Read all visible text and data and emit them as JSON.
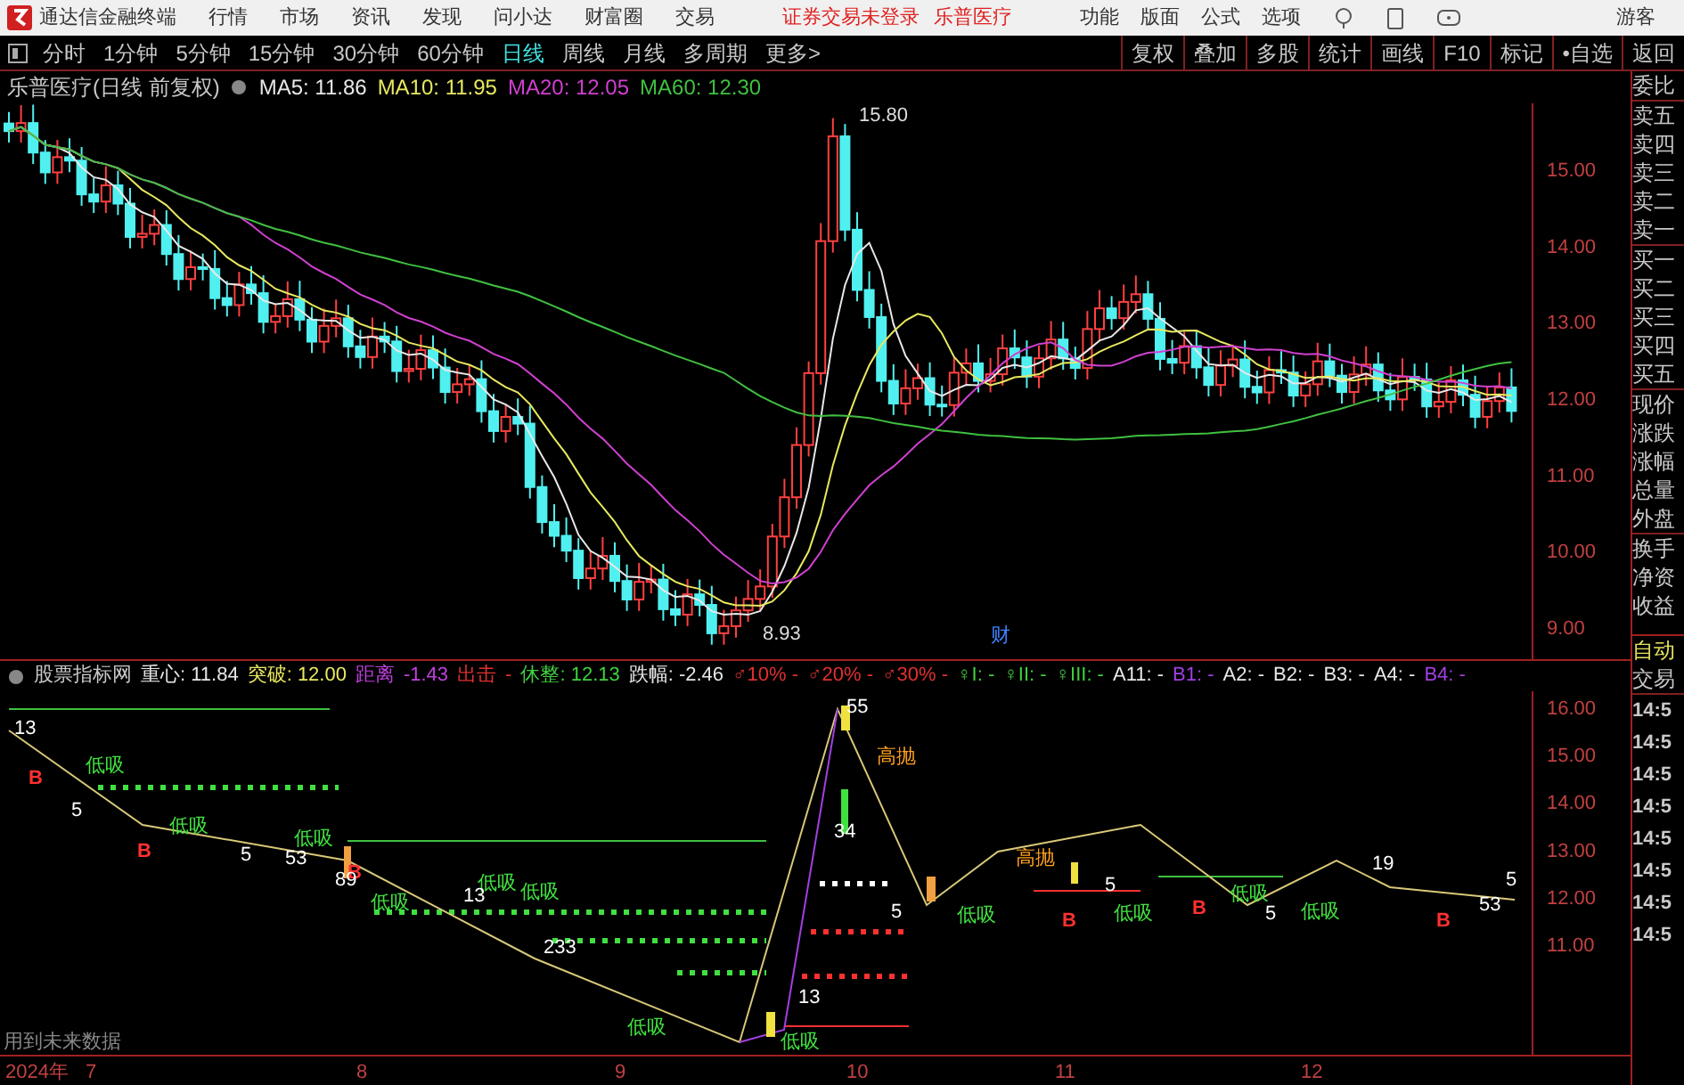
{
  "app": {
    "title": "通达信金融终端",
    "menu": [
      "行情",
      "市场",
      "资讯",
      "发现",
      "问小达",
      "财富圈",
      "交易"
    ],
    "notices": [
      "证券交易未登录",
      "乐普医疗"
    ],
    "right_menu": [
      "功能",
      "版面",
      "公式",
      "选项"
    ],
    "user": "游客"
  },
  "periods": [
    {
      "label": "分时",
      "selected": false
    },
    {
      "label": "1分钟",
      "selected": false
    },
    {
      "label": "5分钟",
      "selected": false
    },
    {
      "label": "15分钟",
      "selected": false
    },
    {
      "label": "30分钟",
      "selected": false
    },
    {
      "label": "60分钟",
      "selected": false
    },
    {
      "label": "日线",
      "selected": true
    },
    {
      "label": "周线",
      "selected": false
    },
    {
      "label": "月线",
      "selected": false
    },
    {
      "label": "多周期",
      "selected": false
    },
    {
      "label": "更多>",
      "selected": false
    }
  ],
  "tools": [
    "复权",
    "叠加",
    "多股",
    "统计",
    "画线",
    "F10",
    "标记",
    "•自选",
    "返回"
  ],
  "main_chart": {
    "title": "乐普医疗(日线 前复权)",
    "ma": [
      {
        "label": "MA5: 11.86",
        "color": "#e8e8e8"
      },
      {
        "label": "MA10: 11.95",
        "color": "#e8e860"
      },
      {
        "label": "MA20: 12.05",
        "color": "#d040d0"
      },
      {
        "label": "MA60: 12.30",
        "color": "#40c040"
      }
    ],
    "high_label": "15.80",
    "low_label": "8.93",
    "event_mark": "财",
    "price_axis": [
      "15.00",
      "14.00",
      "13.00",
      "12.00",
      "11.00",
      "10.00",
      "9.00"
    ]
  },
  "indicator": {
    "name": "股票指标网",
    "items": [
      {
        "text": "重心: 11.84",
        "color": "#e8e8e8"
      },
      {
        "text": "突破: 12.00",
        "color": "#e8e860"
      },
      {
        "text": "距离",
        "color": "#c040e0"
      },
      {
        "text": "-1.43",
        "color": "#c040e0"
      },
      {
        "text": "出击",
        "color": "#e03030"
      },
      {
        "text": "-",
        "color": "#e03030"
      },
      {
        "text": "休整: 12.13",
        "color": "#40d040"
      },
      {
        "text": "跌幅: -2.46",
        "color": "#e8e8e8"
      },
      {
        "text": "♂10% -",
        "color": "#e03030"
      },
      {
        "text": "♂20% -",
        "color": "#e03030"
      },
      {
        "text": "♂30% -",
        "color": "#e03030"
      },
      {
        "text": "♀I: -",
        "color": "#40d040"
      },
      {
        "text": "♀II: -",
        "color": "#40d040"
      },
      {
        "text": "♀III: -",
        "color": "#40d040"
      },
      {
        "text": "A11: -",
        "color": "#e8e8e8"
      },
      {
        "text": "B1: -",
        "color": "#a040e0"
      },
      {
        "text": "A2: -",
        "color": "#e8e8e8"
      },
      {
        "text": "B2: -",
        "color": "#e8e8e8"
      },
      {
        "text": "B3: -",
        "color": "#e8e8e8"
      },
      {
        "text": "A4: -",
        "color": "#e8e8e8"
      },
      {
        "text": "B4: -",
        "color": "#a040e0"
      }
    ],
    "price_axis": [
      "16.00",
      "15.00",
      "14.00",
      "13.00",
      "12.00",
      "11.00"
    ],
    "signals": [
      {
        "text": "13",
        "kind": "count"
      },
      {
        "text": "低吸",
        "kind": "low"
      },
      {
        "text": "B",
        "kind": "buy"
      },
      {
        "text": "5",
        "kind": "count"
      },
      {
        "text": "B",
        "kind": "buy"
      },
      {
        "text": "低吸",
        "kind": "low"
      },
      {
        "text": "5",
        "kind": "count"
      },
      {
        "text": "低吸",
        "kind": "low"
      },
      {
        "text": "53",
        "kind": "count"
      },
      {
        "text": "B",
        "kind": "buy"
      },
      {
        "text": "89",
        "kind": "count"
      },
      {
        "text": "低吸",
        "kind": "low"
      },
      {
        "text": "低吸",
        "kind": "low"
      },
      {
        "text": "13",
        "kind": "count"
      },
      {
        "text": "低吸",
        "kind": "low"
      },
      {
        "text": "233",
        "kind": "count"
      },
      {
        "text": "低吸",
        "kind": "low"
      },
      {
        "text": "13",
        "kind": "count"
      },
      {
        "text": "低吸",
        "kind": "low"
      },
      {
        "text": "55",
        "kind": "count"
      },
      {
        "text": "高抛",
        "kind": "high"
      },
      {
        "text": "34",
        "kind": "count"
      },
      {
        "text": "5",
        "kind": "count"
      },
      {
        "text": "低吸",
        "kind": "low"
      },
      {
        "text": "高抛",
        "kind": "high"
      },
      {
        "text": "B",
        "kind": "buy"
      },
      {
        "text": "低吸",
        "kind": "low"
      },
      {
        "text": "5",
        "kind": "count"
      },
      {
        "text": "B",
        "kind": "buy"
      },
      {
        "text": "低吸",
        "kind": "low"
      },
      {
        "text": "5",
        "kind": "count"
      },
      {
        "text": "低吸",
        "kind": "low"
      },
      {
        "text": "19",
        "kind": "count"
      },
      {
        "text": "B",
        "kind": "buy"
      },
      {
        "text": "53",
        "kind": "count"
      },
      {
        "text": "5",
        "kind": "count"
      }
    ],
    "note": "用到未来数据"
  },
  "dates": [
    "2024年",
    "7",
    "8",
    "9",
    "10",
    "11",
    "12"
  ],
  "quote_panel": {
    "labels": [
      "委比",
      "卖五",
      "卖四",
      "卖三",
      "卖二",
      "卖一",
      "买一",
      "买二",
      "买三",
      "买四",
      "买五",
      "现价",
      "涨跌",
      "涨幅",
      "总量",
      "外盘",
      "换手",
      "净资",
      "收益"
    ],
    "auto": "自动",
    "trade": "交易",
    "times": [
      "14:5",
      "14:5",
      "14:5",
      "14:5",
      "14:5",
      "14:5",
      "14:5",
      "14:5"
    ]
  }
}
